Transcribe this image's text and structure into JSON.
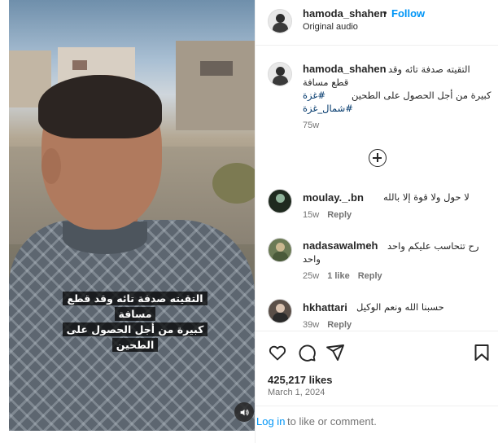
{
  "header": {
    "username": "hamoda_shahen",
    "dot": "•",
    "follow_label": "Follow",
    "subtitle": "Original audio"
  },
  "video": {
    "caption_lines": [
      "التقيته صدفة تائه وقد قطع",
      "مسافة",
      "كبيرة من أجل الحصول على",
      "الطحين"
    ]
  },
  "post": {
    "username": "hamoda_shahen",
    "line1": "التقيته صدفة تائه وقد",
    "line2": "قطع مسافة",
    "line3": "كبيرة من أجل الحصول على الطحين",
    "hashtag1": "#غزة",
    "hashtag2": "#شمال_غزة",
    "age": "75w"
  },
  "comments": [
    {
      "username": "moulay._.bn",
      "text": "لا حول ولا قوة إلا بالله",
      "age": "15w",
      "likes": "",
      "reply": "Reply"
    },
    {
      "username": "nadasawalmeh",
      "text_line1": "رح تتحاسب عليكم واحد",
      "text_line2": "واحد",
      "age": "25w",
      "likes": "1 like",
      "reply": "Reply"
    },
    {
      "username": "hkhattari",
      "text": "حسبنا الله ونعم الوكيل",
      "age": "39w",
      "likes": "",
      "reply": "Reply"
    }
  ],
  "stats": {
    "likes": "425,217 likes",
    "date": "March 1, 2024"
  },
  "login": {
    "link": "Log in",
    "rest": "to like or comment."
  },
  "colors": {
    "accent": "#0095f6",
    "hashtag": "#00376b",
    "muted": "#737373",
    "text": "#262626"
  }
}
